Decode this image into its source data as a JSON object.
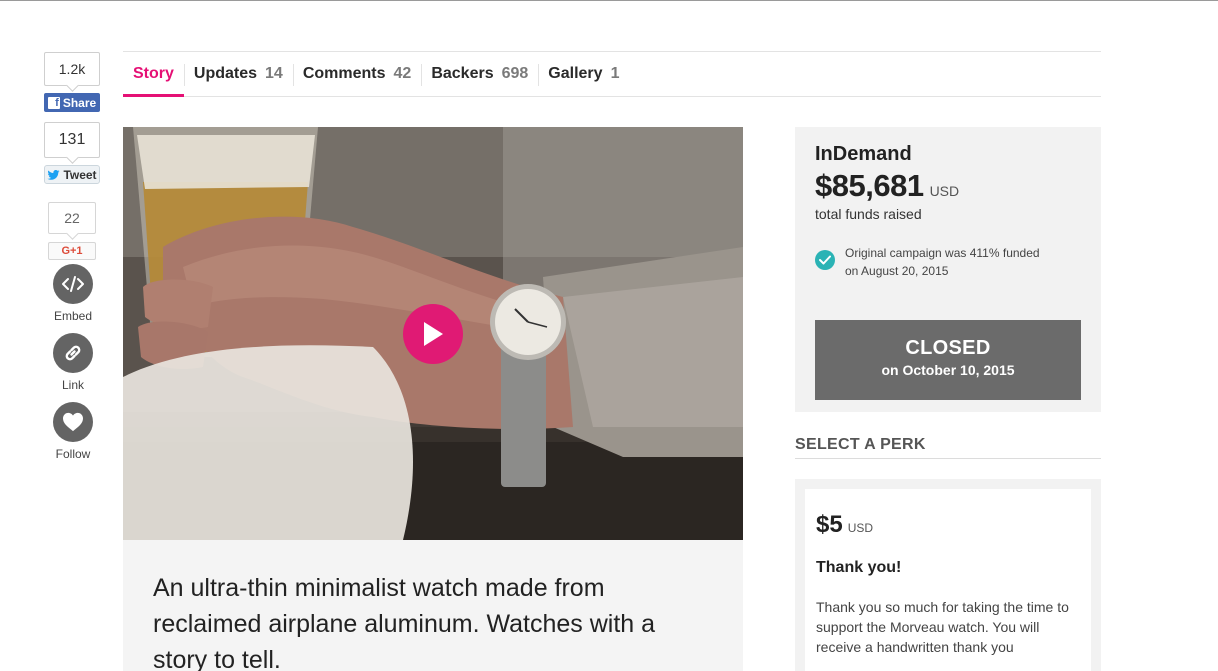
{
  "social": {
    "facebook": {
      "count": "1.2k",
      "label": "Share",
      "icon": "facebook-icon"
    },
    "twitter": {
      "count": "131",
      "label": "Tweet",
      "icon": "twitter-bird-icon"
    },
    "google": {
      "count": "22",
      "label": "G+1"
    },
    "embed": {
      "label": "Embed",
      "icon": "code-icon"
    },
    "link": {
      "label": "Link",
      "icon": "link-icon"
    },
    "follow": {
      "label": "Follow",
      "icon": "heart-icon"
    }
  },
  "tabs": [
    {
      "label": "Story",
      "count": ""
    },
    {
      "label": "Updates",
      "count": "14"
    },
    {
      "label": "Comments",
      "count": "42"
    },
    {
      "label": "Backers",
      "count": "698"
    },
    {
      "label": "Gallery",
      "count": "1"
    }
  ],
  "video": {
    "play_icon": "play-icon"
  },
  "story": {
    "summary": "An ultra-thin minimalist watch made from reclaimed airplane aluminum. Watches with a story to tell."
  },
  "funding": {
    "label": "InDemand",
    "amount": "$85,681",
    "currency": "USD",
    "subtitle": "total funds raised",
    "original_line1": "Original campaign was 411% funded",
    "original_line2": "on August 20, 2015",
    "closed_title": "CLOSED",
    "closed_date": "on October 10, 2015"
  },
  "perks": {
    "heading": "SELECT A PERK",
    "items": [
      {
        "price": "$5",
        "currency": "USD",
        "title": "Thank you!",
        "description": "Thank you so much for taking the time to support the Morveau watch. You will receive a handwritten thank you"
      }
    ]
  },
  "colors": {
    "accent": "#e51075",
    "play": "#e01a74",
    "facebook": "#4267b2",
    "check": "#2bb3b5",
    "closed": "#6b6b6b"
  }
}
